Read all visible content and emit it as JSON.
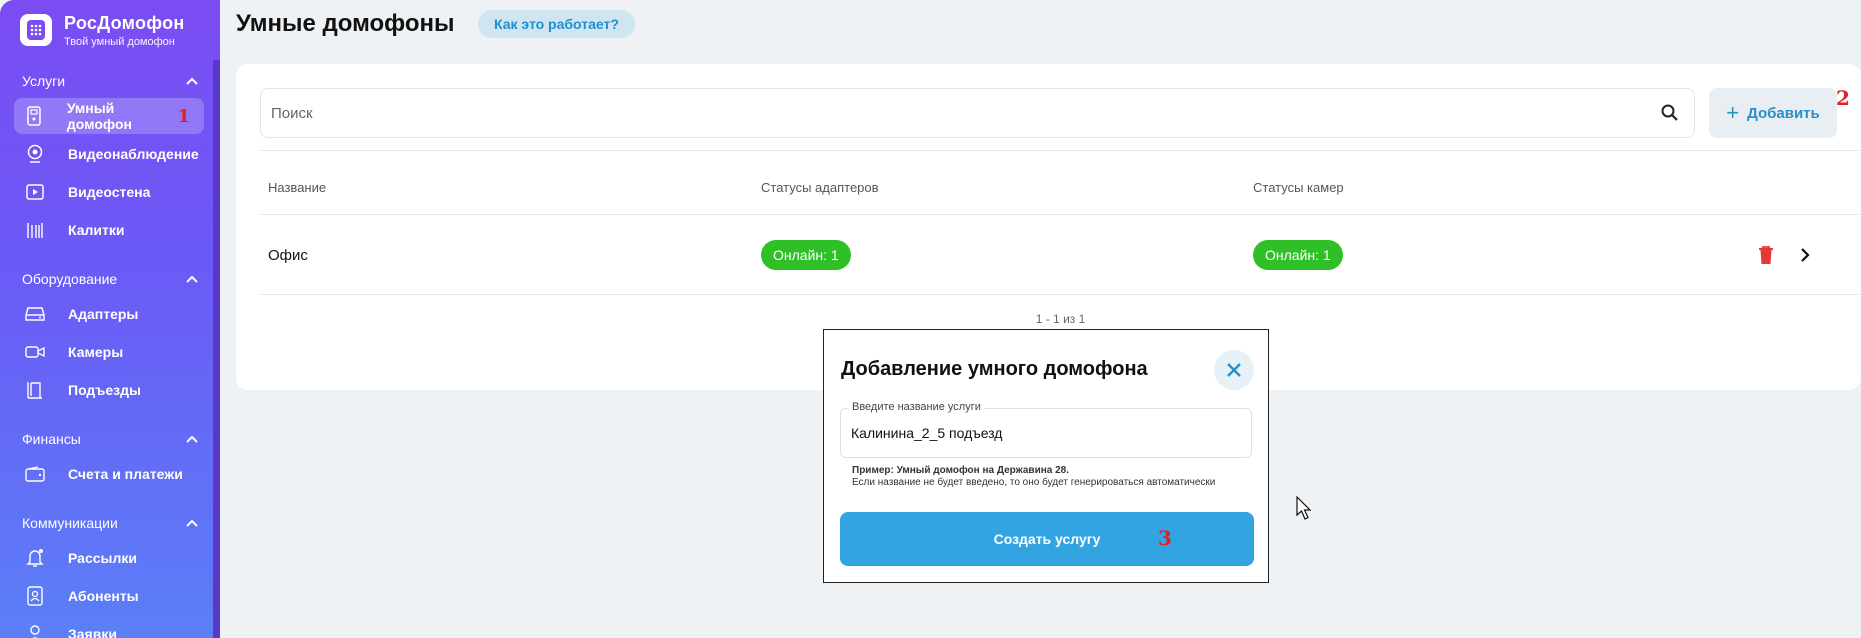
{
  "brand": {
    "name": "РосДомофон",
    "subtitle": "Твой умный домофон"
  },
  "sidebar": {
    "sections": [
      {
        "title": "Услуги",
        "items": [
          {
            "label": "Умный домофон",
            "icon": "intercom-icon",
            "marker": "1"
          },
          {
            "label": "Видеонаблюдение",
            "icon": "webcam-icon"
          },
          {
            "label": "Видеостена",
            "icon": "video-wall-icon"
          },
          {
            "label": "Калитки",
            "icon": "gate-icon"
          }
        ]
      },
      {
        "title": "Оборудование",
        "items": [
          {
            "label": "Адаптеры",
            "icon": "adapter-icon"
          },
          {
            "label": "Камеры",
            "icon": "camera-icon"
          },
          {
            "label": "Подъезды",
            "icon": "door-icon"
          }
        ]
      },
      {
        "title": "Финансы",
        "items": [
          {
            "label": "Счета и платежи",
            "icon": "wallet-icon"
          }
        ]
      },
      {
        "title": "Коммуникации",
        "items": [
          {
            "label": "Рассылки",
            "icon": "bell-icon"
          },
          {
            "label": "Абоненты",
            "icon": "contacts-icon"
          },
          {
            "label": "Заявки",
            "icon": "user-icon"
          }
        ]
      }
    ]
  },
  "header": {
    "title": "Умные домофоны",
    "how_label": "Как это работает?"
  },
  "search": {
    "placeholder": "Поиск"
  },
  "add_button": {
    "label": "Добавить",
    "marker": "2"
  },
  "table": {
    "columns": [
      "Название",
      "Статусы адаптеров",
      "Статусы камер"
    ],
    "rows": [
      {
        "name": "Офис",
        "adapters": "Онлайн: 1",
        "cameras": "Онлайн: 1"
      }
    ],
    "pagination": "1 - 1 из 1"
  },
  "modal": {
    "title": "Добавление умного домофона",
    "field_label": "Введите название услуги",
    "field_value": "Калинина_2_5 подъезд",
    "hint_bold": "Пример: Умный домофон на Державина 28.",
    "hint_text": "Если название не будет введено, то оно будет генерироваться автоматически",
    "submit_label": "Создать услугу",
    "marker": "3"
  },
  "colors": {
    "accent": "#31a4e1",
    "online": "#2fbf27",
    "danger": "#e53935",
    "sidebar_top": "#7b4cf2",
    "sidebar_bottom": "#5b7ff7"
  }
}
